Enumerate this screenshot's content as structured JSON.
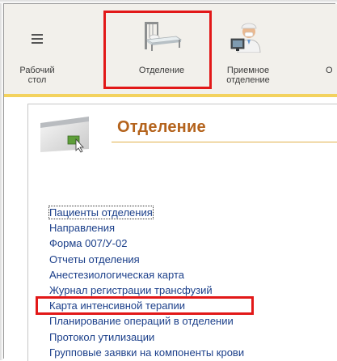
{
  "toolbar": {
    "items": [
      {
        "label": "Рабочий\nстол",
        "icon": "hamburger-menu-icon"
      },
      {
        "label": "Отделение",
        "icon": "hospital-bed-icon"
      },
      {
        "label": "Приемное\nотделение",
        "icon": "doctor-at-computer-icon"
      },
      {
        "label": "О",
        "icon": ""
      }
    ]
  },
  "section": {
    "title": "Отделение",
    "icon": "window-cursor-icon"
  },
  "links": [
    "Пациенты отделения",
    "Направления",
    "Форма 007/У-02",
    "Отчеты отделения",
    "Анестезиологическая карта",
    "Журнал регистрации трансфузий",
    "Карта интенсивной терапии",
    "Планирование операций в отделении",
    "Протокол утилизации",
    "Групповые заявки на компоненты крови"
  ],
  "colors": {
    "highlight": "#e21818",
    "title": "#b4631c",
    "link": "#1b3f8a",
    "toolbar_bg": "#f2f0eb",
    "separator": "#f3d25e"
  }
}
